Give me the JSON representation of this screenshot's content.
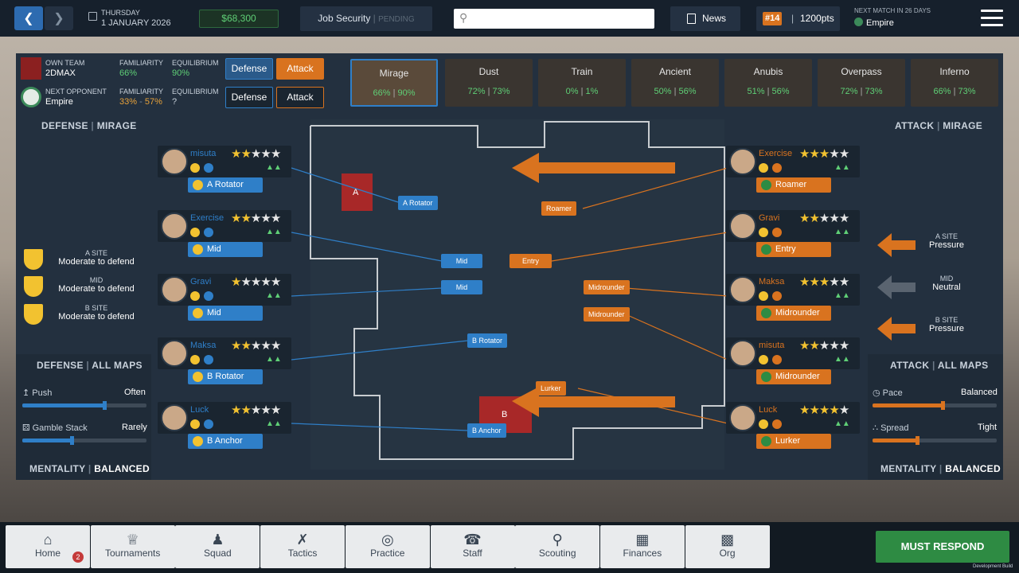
{
  "topbar": {
    "weekday": "THURSDAY",
    "date": "1 JANUARY 2026",
    "money": "$68,300",
    "job_security_label": "Job Security",
    "job_security_status": "PENDING",
    "search_placeholder": "",
    "news_label": "News",
    "rank": "#14",
    "points": "1200pts",
    "next_match_label": "NEXT MATCH IN 26 DAYS",
    "next_match_team": "Empire"
  },
  "teams": {
    "own_label": "OWN TEAM",
    "own_name": "2DMAX",
    "familiarity_label": "FAMILIARITY",
    "equilibrium_label": "EQUILIBRIUM",
    "own_familiarity": "66%",
    "own_equilibrium": "90%",
    "opp_label": "NEXT OPPONENT",
    "opp_name": "Empire",
    "opp_familiarity_a": "33%",
    "opp_familiarity_b": "57%",
    "opp_equilibrium": "?",
    "defense_btn": "Defense",
    "attack_btn": "Attack"
  },
  "maps": [
    {
      "name": "Mirage",
      "a": "66%",
      "b": "90%"
    },
    {
      "name": "Dust",
      "a": "72%",
      "b": "73%"
    },
    {
      "name": "Train",
      "a": "0%",
      "b": "1%"
    },
    {
      "name": "Ancient",
      "a": "50%",
      "b": "56%"
    },
    {
      "name": "Anubis",
      "a": "51%",
      "b": "56%"
    },
    {
      "name": "Overpass",
      "a": "72%",
      "b": "73%"
    },
    {
      "name": "Inferno",
      "a": "66%",
      "b": "73%"
    }
  ],
  "defense": {
    "title_a": "DEFENSE",
    "title_b": "MIRAGE",
    "players": [
      {
        "name": "misuta",
        "role": "A Rotator"
      },
      {
        "name": "Exercise",
        "role": "Mid"
      },
      {
        "name": "Gravi",
        "role": "Mid"
      },
      {
        "name": "Maksa",
        "role": "B Rotator"
      },
      {
        "name": "Luck",
        "role": "B Anchor"
      }
    ],
    "sites": [
      {
        "label": "A SITE",
        "value": "Moderate to defend"
      },
      {
        "label": "MID",
        "value": "Moderate to defend"
      },
      {
        "label": "B SITE",
        "value": "Moderate to defend"
      }
    ],
    "all_maps_a": "DEFENSE",
    "all_maps_b": "ALL MAPS",
    "push_label": "Push",
    "push_value": "Often",
    "gamble_label": "Gamble Stack",
    "gamble_value": "Rarely",
    "mentality_a": "MENTALITY",
    "mentality_b": "BALANCED"
  },
  "attack": {
    "title_a": "ATTACK",
    "title_b": "MIRAGE",
    "players": [
      {
        "name": "Exercise",
        "role": "Roamer"
      },
      {
        "name": "Gravi",
        "role": "Entry"
      },
      {
        "name": "Maksa",
        "role": "Midrounder"
      },
      {
        "name": "misuta",
        "role": "Midrounder"
      },
      {
        "name": "Luck",
        "role": "Lurker"
      }
    ],
    "sites": [
      {
        "label": "A SITE",
        "value": "Pressure"
      },
      {
        "label": "MID",
        "value": "Neutral"
      },
      {
        "label": "B SITE",
        "value": "Pressure"
      }
    ],
    "all_maps_a": "ATTACK",
    "all_maps_b": "ALL MAPS",
    "pace_label": "Pace",
    "pace_value": "Balanced",
    "spread_label": "Spread",
    "spread_value": "Tight",
    "mentality_a": "MENTALITY",
    "mentality_b": "BALANCED"
  },
  "map_labels": {
    "site_a": "A",
    "site_b": "B",
    "def_a_rotator": "A Rotator",
    "def_mid1": "Mid",
    "def_mid2": "Mid",
    "def_b_rotator": "B Rotator",
    "def_b_anchor": "B Anchor",
    "att_roamer": "Roamer",
    "att_entry": "Entry",
    "att_mid1": "Midrounder",
    "att_mid2": "Midrounder",
    "att_lurker": "Lurker"
  },
  "nav": {
    "home": "Home",
    "home_badge": "2",
    "tournaments": "Tournaments",
    "squad": "Squad",
    "tactics": "Tactics",
    "practice": "Practice",
    "staff": "Staff",
    "scouting": "Scouting",
    "finances": "Finances",
    "org": "Org",
    "must_respond": "MUST RESPOND",
    "dev_build": "Development Build"
  },
  "colors": {
    "defense": "#2f7fc8",
    "attack": "#d9731f",
    "good": "#5fcf76"
  }
}
